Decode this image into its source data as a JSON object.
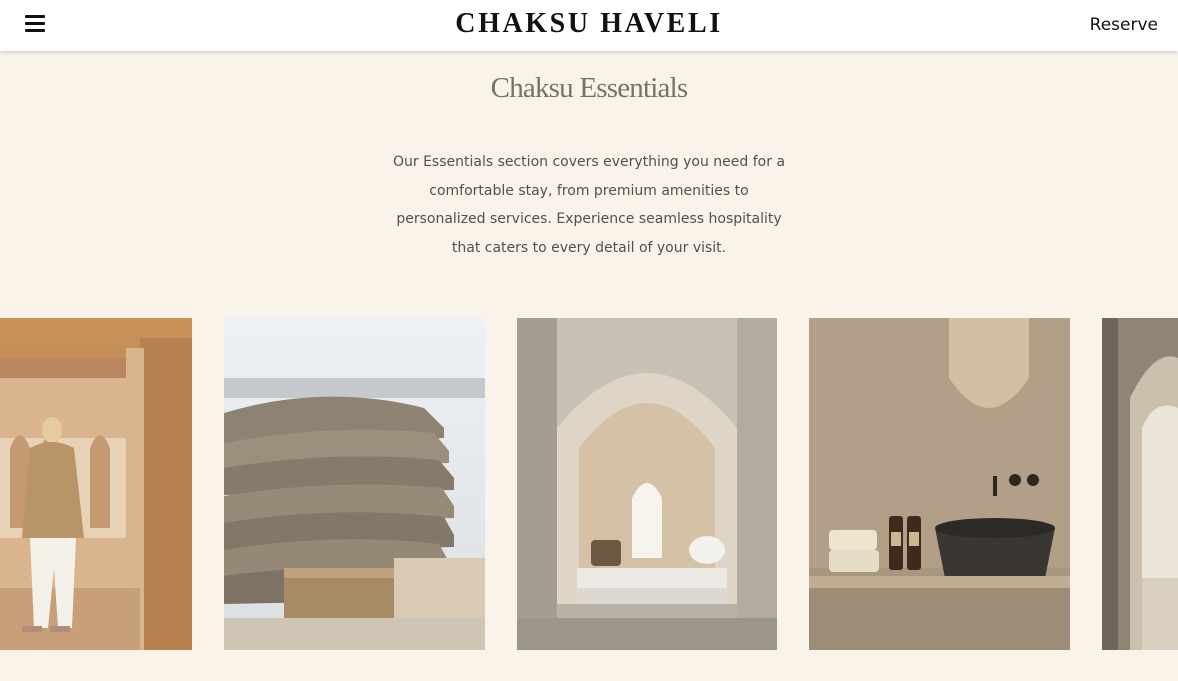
{
  "header": {
    "menu_icon": "hamburger-menu-icon",
    "brand": "CHAKSU HAVELI",
    "reserve_label": "Reserve"
  },
  "section": {
    "title": "Chaksu Essentials",
    "description_lines": [
      "Our Essentials section covers everything you need for a",
      "comfortable stay, from premium amenities to",
      "personalized services. Experience seamless hospitality",
      "that caters to every detail of your visit."
    ]
  },
  "gallery": {
    "images": [
      "woman-in-corridor-photo",
      "folded-linen-stack-photo",
      "arched-alcove-bed-photo",
      "stone-basin-bathroom-photo",
      "arched-doorway-photo"
    ]
  },
  "colors": {
    "page_background": "#faf3ea",
    "header_background": "#ffffff",
    "heading": "#7c7066",
    "body_text": "#555049"
  }
}
